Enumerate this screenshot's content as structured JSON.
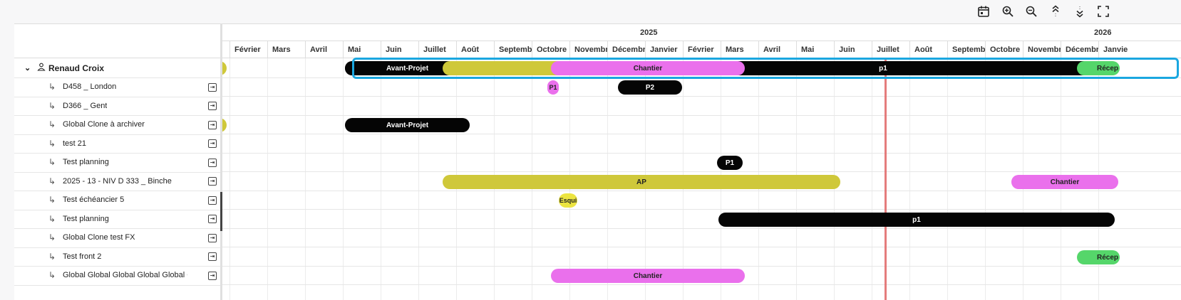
{
  "toolbar": {
    "icons": [
      "calendar-icon",
      "zoom-in-icon",
      "zoom-out-icon",
      "collapse-all-icon",
      "expand-all-icon",
      "fullscreen-icon"
    ]
  },
  "group": {
    "name": "Renaud Croix"
  },
  "projects": [
    "D458 _ London",
    "D366 _ Gent",
    "Global Clone à archiver",
    "test 21",
    "Test planning",
    "2025 - 13 - NIV D 333 _ Binche",
    "Test échéancier 5",
    "Test planning",
    "Global Clone test FX",
    "Test front 2",
    "Global Global Global Global Global Glo"
  ],
  "years": [
    "2025",
    "2026"
  ],
  "months": [
    "·",
    "Février",
    "Mars",
    "Avril",
    "Mai",
    "Juin",
    "Juillet",
    "Août",
    "Septemb",
    "Octobre",
    "Novembr",
    "Décembr",
    "Janvier",
    "Février",
    "Mars",
    "Avril",
    "Mai",
    "Juin",
    "Juillet",
    "Août",
    "Septemb",
    "Octobre",
    "Novembr",
    "Décembr",
    "Janvie"
  ],
  "bars": {
    "group_avant_projet": "Avant-Projet",
    "group_chantier": "Chantier",
    "group_p1": "p1",
    "group_reception": "Récep",
    "d458_p1": "P1",
    "d458_p2": "P2",
    "clone_avant_projet": "Avant-Projet",
    "test_planning_p1": "P1",
    "binche_ap": "AP",
    "binche_chantier": "Chantier",
    "echeancier_esqui": "Esqui",
    "test_planning2_p1": "p1",
    "front_reception": "Récep",
    "global_chantier": "Chantier"
  },
  "colors": {
    "black": "#050505",
    "yellow": "#cfc83a",
    "pink": "#ea70ec",
    "green": "#55d66a",
    "today_line": "#e06666",
    "selection": "#1aa7e0"
  }
}
